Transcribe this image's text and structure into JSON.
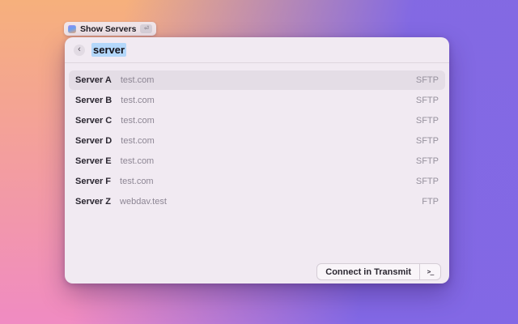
{
  "hint_pill": {
    "app_icon": "transmit-app-icon",
    "label": "Show Servers",
    "key_badge": "⏎"
  },
  "search_bar": {
    "back_chevron": "‹",
    "query": "server"
  },
  "server_list": {
    "rows": [
      {
        "name": "Server A",
        "host": "test.com",
        "protocol": "SFTP",
        "selected": true
      },
      {
        "name": "Server B",
        "host": "test.com",
        "protocol": "SFTP",
        "selected": false
      },
      {
        "name": "Server C",
        "host": "test.com",
        "protocol": "SFTP",
        "selected": false
      },
      {
        "name": "Server D",
        "host": "test.com",
        "protocol": "SFTP",
        "selected": false
      },
      {
        "name": "Server E",
        "host": "test.com",
        "protocol": "SFTP",
        "selected": false
      },
      {
        "name": "Server F",
        "host": "test.com",
        "protocol": "SFTP",
        "selected": false
      },
      {
        "name": "Server Z",
        "host": "webdav.test",
        "protocol": "FTP",
        "selected": false
      }
    ]
  },
  "footer": {
    "connect_button": "Connect in Transmit",
    "terminal_glyph": ">_"
  },
  "colors": {
    "bg_top_left": "#f6b07c",
    "bg_bottom_left": "#f08bc2",
    "bg_right": "#8068e5",
    "panel_bg": "#f1eaf2",
    "row_selected_bg": "#e4dde6",
    "text_primary": "#2a2630",
    "text_secondary": "#8d8694",
    "selection_highlight": "#b3d7fa"
  }
}
